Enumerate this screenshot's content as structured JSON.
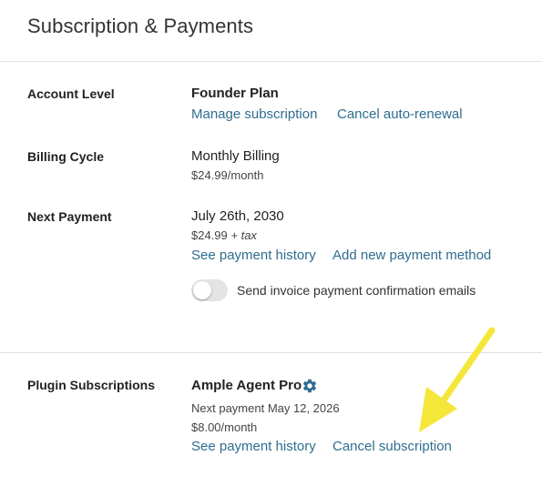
{
  "header": {
    "title": "Subscription & Payments"
  },
  "account": {
    "label": "Account Level",
    "plan": "Founder Plan",
    "manage_link": "Manage subscription",
    "cancel_link": "Cancel auto-renewal"
  },
  "billing": {
    "label": "Billing Cycle",
    "cycle": "Monthly Billing",
    "price": "$24.99/month"
  },
  "next_payment": {
    "label": "Next Payment",
    "date": "July 26th, 2030",
    "amount": "$24.99",
    "tax_suffix": "+ tax",
    "history_link": "See payment history",
    "add_method_link": "Add new payment method",
    "email_toggle_label": "Send invoice payment confirmation emails",
    "email_toggle_on": false
  },
  "plugins": {
    "label": "Plugin Subscriptions",
    "items": [
      {
        "name": "Ample Agent Pro",
        "next_payment": "Next payment May 12, 2026",
        "price": "$8.00/month",
        "history_link": "See payment history",
        "cancel_link": "Cancel subscription"
      }
    ]
  },
  "colors": {
    "link": "#2e6d8f",
    "gear": "#2e6d8f",
    "annotation_arrow": "#f5e63a"
  },
  "icons": {
    "plugin_settings": "gear-icon",
    "annotation": "arrow-icon"
  }
}
